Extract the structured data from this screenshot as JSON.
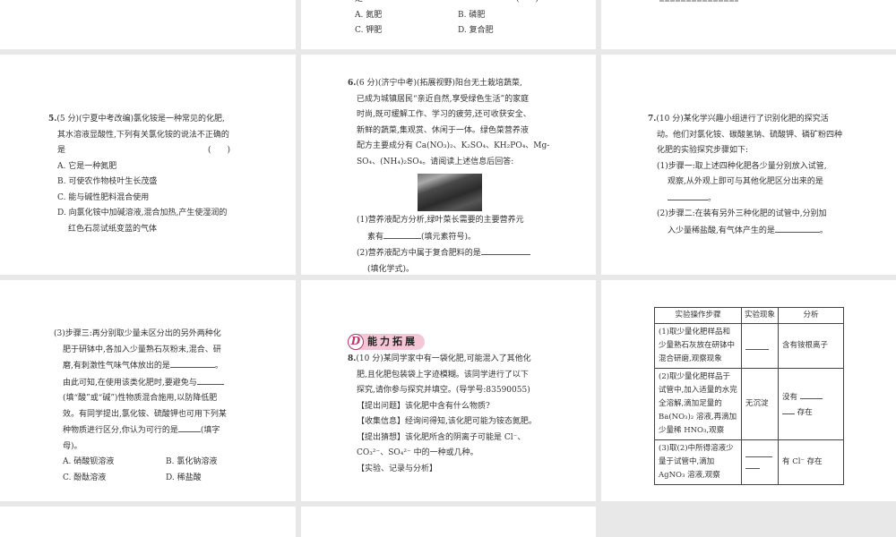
{
  "panels": {
    "top_middle": {
      "line_partial": "是",
      "paren": "(　　)",
      "options": [
        "A. 氮肥",
        "B. 磷肥",
        "C. 钾肥",
        "D. 复合肥"
      ]
    },
    "q5": {
      "number": "5.",
      "lines": [
        "(5 分)(宁夏中考改编)氯化铵是一种常见的化肥,",
        "其水溶液显酸性,下列有关氯化铵的说法不正确的",
        "是"
      ],
      "paren": "(　　)",
      "options": [
        "A. 它是一种氮肥",
        "B. 可使农作物枝叶生长茂盛",
        "C. 能与碱性肥料混合使用",
        "D. 向氯化铵中加碱溶液,混合加热,产生使湿润的",
        "红色石蕊试纸变蓝的气体"
      ]
    },
    "q6": {
      "number": "6.",
      "lines": [
        "(6 分)(济宁中考)(拓展视野)阳台无土栽培蔬菜,",
        "已成为城镇居民“亲近自然,享受绿色生活”的家庭",
        "时尚,既可缓解工作、学习的疲劳,还可收获安全、",
        "新鲜的蔬菜,集观赏、休闲于一体。绿色菜营养液",
        "配方主要成分有 Ca(NO₃)₂、K₂SO₄、KH₂PO₄、Mg-",
        "SO₄、(NH₄)₂SO₄。请阅读上述信息后回答:"
      ],
      "sub1a": "(1)营养液配方分析,绿叶菜长需要的主要营养元",
      "sub1b_pre": "素有",
      "sub1b_post": "(填元素符号)。",
      "sub2a": "(2)营养液配方中属于复合肥料的是",
      "sub2b": "(填化学式)。"
    },
    "q7": {
      "number": "7.",
      "lines": [
        "(10 分)某化学兴趣小组进行了识别化肥的探究活",
        "动。他们对氯化铵、碳酸氢钠、硫酸钾、磷矿粉四种",
        "化肥的实验探究步骤如下:"
      ],
      "step1a": "(1)步骤一:取上述四种化肥各少量分别放入试管,",
      "step1b": "观察,从外观上即可与其他化肥区分出来的是",
      "step1c": "。",
      "step2a": "(2)步骤二:在装有另外三种化肥的试管中,分别加",
      "step2b": "入少量稀盐酸,有气体产生的是",
      "step2c": "。"
    },
    "q7_step3": {
      "lines": [
        "(3)步骤三:再分别取少量未区分出的另外两种化",
        "肥于研钵中,各加入少量熟石灰粉末,混合、研",
        "磨,有刺激性气味气体放出的是",
        "由此可知,在使用该类化肥时,要避免与",
        "(填“酸”或“碱”)性物质混合施用,以防降低肥",
        "效。有同学提出,氯化铵、硫酸钾也可用下列某",
        "种物质进行区分,你认为可行的是",
        "(填字",
        "母)。"
      ],
      "options": [
        "A. 硝酸钡溶液",
        "B. 氯化钠溶液",
        "C. 酚酞溶液",
        "D. 稀盐酸"
      ]
    },
    "q8": {
      "badge_letter": "D",
      "badge_title": "能力拓展",
      "number": "8.",
      "lines": [
        "(10 分)某同学家中有一袋化肥,可能混入了其他化",
        "肥,且化肥包装袋上字迹模糊。该同学进行了以下",
        "探究,请你参与探究并填空。(导学号:83590055)",
        "【提出问题】该化肥中含有什么物质?",
        "【收集信息】经询问得知,该化肥可能为铵态氮肥。",
        "【提出猜想】该化肥所含的阴离子可能是 Cl⁻、",
        "CO₃²⁻、SO₄²⁻ 中的一种或几种。",
        "【实验、记录与分析】"
      ]
    },
    "table": {
      "headers": [
        "实验操作步骤",
        "实验现象",
        "分析"
      ],
      "rows": [
        {
          "step": "(1)取少量化肥样品和少量熟石灰放在研钵中混合研磨,观察现象",
          "phenomenon": "",
          "analysis": "含有铵根离子"
        },
        {
          "step": "(2)取少量化肥样品于试管中,加入适量的水完全溶解,滴加足量的 Ba(NO₃)₂ 溶液,再滴加少量稀 HNO₃,观察",
          "phenomenon": "无沉淀",
          "analysis_pre": "没有",
          "analysis_post": "存在"
        },
        {
          "step": "(3)取(2)中所得溶液少量于试管中,滴加 AgNO₃ 溶液,观察",
          "phenomenon": "",
          "analysis": "有 Cl⁻ 存在"
        }
      ]
    }
  }
}
